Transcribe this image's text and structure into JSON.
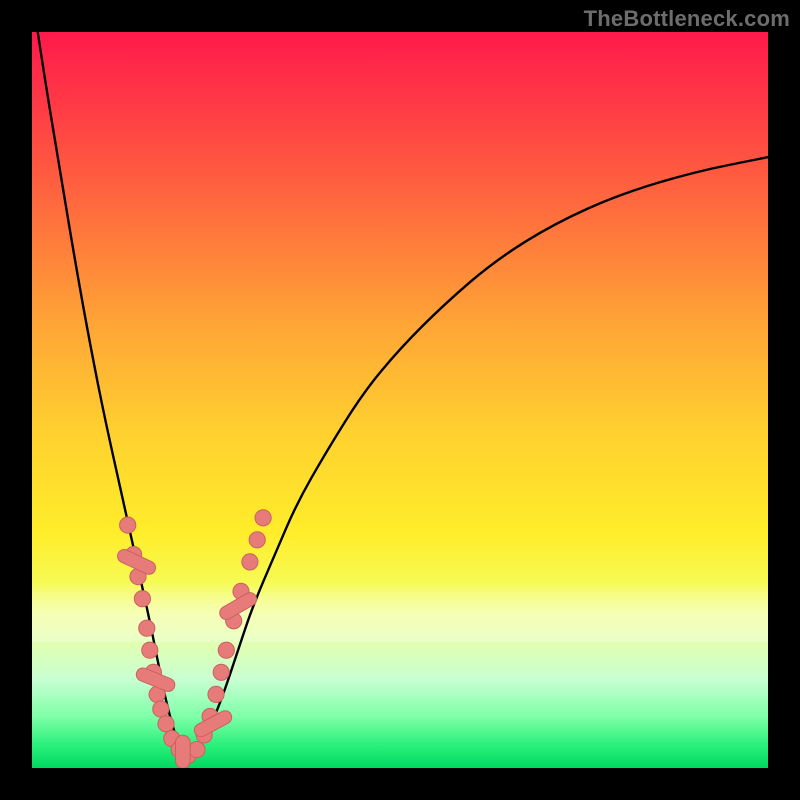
{
  "watermark": "TheBottleneck.com",
  "colors": {
    "frame_bg": "#000000",
    "gradient_top": "#ff1a4b",
    "gradient_bottom": "#00d860",
    "curve_stroke": "#000000",
    "marker_fill": "#e77b79",
    "marker_stroke": "#c9615f"
  },
  "chart_data": {
    "type": "line",
    "title": "",
    "xlabel": "",
    "ylabel": "",
    "xlim": [
      0,
      100
    ],
    "ylim": [
      0,
      100
    ],
    "grid": false,
    "legend": false,
    "note": "Axes are unlabeled in the source image; x/y values are in percent of plot width/height (0,0 = top-left of gradient area). Curve is a V-shaped bottleneck profile.",
    "series": [
      {
        "name": "bottleneck-curve",
        "x": [
          0,
          2,
          4,
          6,
          8,
          10,
          12,
          14,
          16,
          17,
          18,
          19,
          20,
          21,
          22,
          24,
          26,
          28,
          30,
          33,
          36,
          40,
          45,
          50,
          56,
          63,
          71,
          80,
          90,
          100
        ],
        "y": [
          -5,
          8,
          20,
          32,
          43,
          53,
          62,
          71,
          80,
          85,
          90,
          94,
          97,
          98.5,
          98,
          95,
          90,
          84,
          78,
          71,
          64,
          57,
          49,
          43,
          37,
          31,
          26,
          22,
          19,
          17
        ]
      }
    ],
    "markers": {
      "note": "Salmon bead markers clustered near the curve minimum; coords in same percent space.",
      "points": [
        {
          "x": 13.0,
          "y": 67,
          "r": 1.1
        },
        {
          "x": 13.8,
          "y": 71,
          "r": 1.1
        },
        {
          "x": 14.4,
          "y": 74,
          "r": 1.1
        },
        {
          "x": 15.0,
          "y": 77,
          "r": 1.1
        },
        {
          "x": 15.6,
          "y": 81,
          "r": 1.1
        },
        {
          "x": 16.0,
          "y": 84,
          "r": 1.1
        },
        {
          "x": 16.5,
          "y": 87,
          "r": 1.1
        },
        {
          "x": 17.0,
          "y": 90,
          "r": 1.1
        },
        {
          "x": 17.5,
          "y": 92,
          "r": 1.1
        },
        {
          "x": 18.2,
          "y": 94,
          "r": 1.1
        },
        {
          "x": 19.0,
          "y": 96,
          "r": 1.1
        },
        {
          "x": 20.0,
          "y": 97.5,
          "r": 1.1
        },
        {
          "x": 21.2,
          "y": 98.3,
          "r": 1.1
        },
        {
          "x": 22.4,
          "y": 97.5,
          "r": 1.1
        },
        {
          "x": 23.4,
          "y": 95.5,
          "r": 1.1
        },
        {
          "x": 24.2,
          "y": 93,
          "r": 1.1
        },
        {
          "x": 25.0,
          "y": 90,
          "r": 1.1
        },
        {
          "x": 25.7,
          "y": 87,
          "r": 1.1
        },
        {
          "x": 26.4,
          "y": 84,
          "r": 1.1
        },
        {
          "x": 27.4,
          "y": 80,
          "r": 1.1
        },
        {
          "x": 28.4,
          "y": 76,
          "r": 1.1
        },
        {
          "x": 29.6,
          "y": 72,
          "r": 1.1
        },
        {
          "x": 30.6,
          "y": 69,
          "r": 1.1
        },
        {
          "x": 31.4,
          "y": 66,
          "r": 1.1
        }
      ],
      "lozenges": [
        {
          "x": 14.2,
          "y": 72,
          "w": 1.8,
          "h": 5.5,
          "rot": -65
        },
        {
          "x": 16.8,
          "y": 88,
          "w": 1.8,
          "h": 5.5,
          "rot": -68
        },
        {
          "x": 20.5,
          "y": 97.8,
          "w": 2.0,
          "h": 4.5,
          "rot": 0
        },
        {
          "x": 24.6,
          "y": 94,
          "w": 1.8,
          "h": 5.5,
          "rot": 62
        },
        {
          "x": 28.0,
          "y": 78,
          "w": 1.8,
          "h": 5.5,
          "rot": 60
        }
      ]
    }
  }
}
